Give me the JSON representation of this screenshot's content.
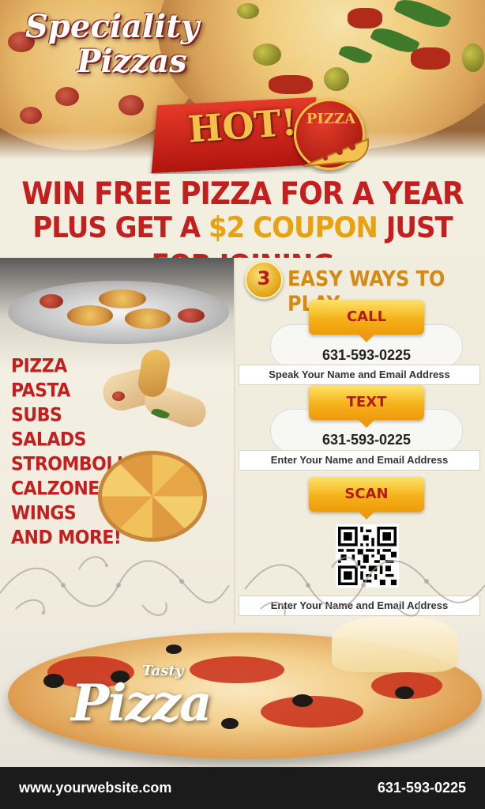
{
  "hero": {
    "brand_line1": "Speciality",
    "brand_line2": "Pizzas",
    "hot_label": "HOT!",
    "badge_label": "PIZZA"
  },
  "headline": {
    "line1": "WIN FREE PIZZA FOR A YEAR",
    "line2_prefix": "PLUS GET A ",
    "line2_highlight": "$2 COUPON",
    "line2_suffix": " JUST FOR JOINING"
  },
  "menu": {
    "items": [
      "PIZZA",
      "PASTA",
      "SUBS",
      "SALADS",
      "STROMBOLI",
      "CALZONES",
      "WINGS",
      "AND MORE!"
    ]
  },
  "ways": {
    "number": "3",
    "title": "EASY WAYS TO PLAY",
    "call": {
      "label": "CALL",
      "phone": "631-593-0225",
      "instruction": "Speak Your Name and Email Address"
    },
    "text": {
      "label": "TEXT",
      "phone": "631-593-0225",
      "instruction": "Enter Your Name and Email Address"
    },
    "scan": {
      "label": "SCAN",
      "instruction": "Enter Your Name and Email Address"
    }
  },
  "bottom": {
    "tasty": "Tasty",
    "pizza": "Pizza"
  },
  "footer": {
    "website": "www.yourwebsite.com",
    "phone": "631-593-0225"
  },
  "colors": {
    "headline_red": "#c41f1f",
    "coupon_gold": "#e8a20f",
    "button_gold": "#f6b21a",
    "footer_bg": "#1b1b1b"
  },
  "icons": [
    "pizza-slice-icon",
    "qr-code-icon",
    "swirl-ornament-icon"
  ]
}
